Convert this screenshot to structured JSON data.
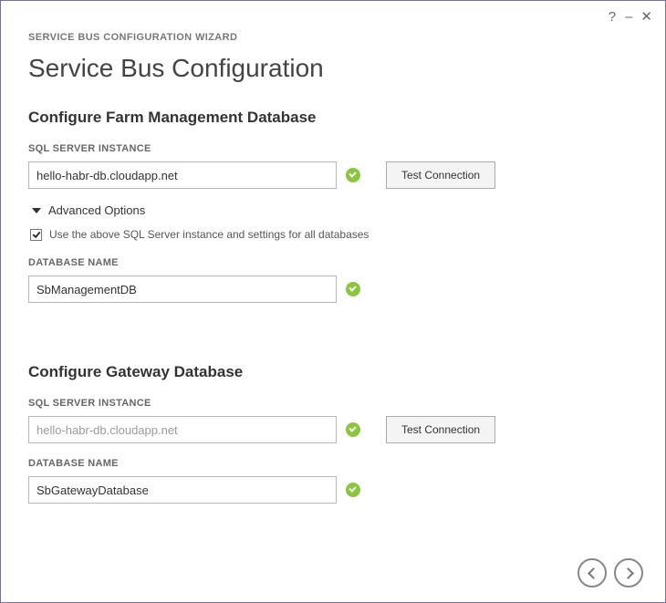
{
  "wizard_label": "SERVICE BUS CONFIGURATION WIZARD",
  "page_title": "Service Bus Configuration",
  "buttons": {
    "test_connection": "Test Connection"
  },
  "labels": {
    "sql_server_instance": "SQL SERVER INSTANCE",
    "database_name": "DATABASE NAME",
    "advanced_options": "Advanced Options"
  },
  "sections": {
    "farm": {
      "heading": "Configure Farm Management Database",
      "sql_instance": "hello-habr-db.cloudapp.net",
      "use_same_checkbox": {
        "checked": true,
        "label": "Use the above SQL Server instance and settings for all databases"
      },
      "db_name": "SbManagementDB"
    },
    "gateway": {
      "heading": "Configure Gateway Database",
      "sql_instance": "hello-habr-db.cloudapp.net",
      "db_name": "SbGatewayDatabase"
    }
  }
}
